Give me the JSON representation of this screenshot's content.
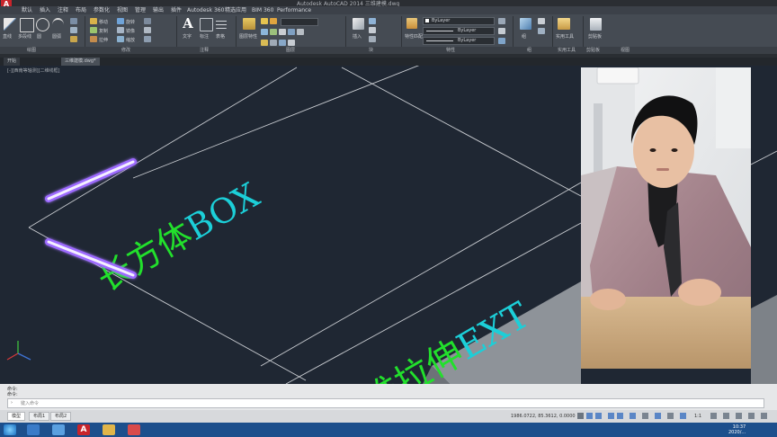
{
  "title": {
    "app_logo": "A",
    "text": "Autodesk AutoCAD 2014  三维建模.dwg"
  },
  "menu": {
    "items": [
      "默认",
      "插入",
      "注释",
      "布局",
      "参数化",
      "视图",
      "管理",
      "输出",
      "插件",
      "Autodesk 360",
      "精选应用",
      "BIM 360",
      "Performance"
    ]
  },
  "ribbon": {
    "properties": {
      "color": "ByLayer",
      "linetype": "ByLayer",
      "lineweight": "ByLayer"
    },
    "buttons": [
      "直线",
      "多段线",
      "圆",
      "圆弧",
      "移动",
      "旋转",
      "复制",
      "镜像",
      "拉伸",
      "缩放",
      "文字",
      "标注",
      "表格",
      "图层特性",
      "插入",
      "特性匹配",
      "组",
      "实用工具",
      "剪贴板"
    ]
  },
  "panels": [
    "绘图",
    "修改",
    "注释",
    "图层",
    "块",
    "特性",
    "组",
    "实用工具",
    "剪贴板",
    "视图"
  ],
  "doc_tabs": [
    "开始",
    "三维建模.dwg*"
  ],
  "viewport_label": "[-][西南等轴测][二维线框]",
  "annotations": {
    "box_cn": "长方体",
    "box_en": "BOX",
    "extrude_cn": "三维拉伸",
    "extrude_en": "EXT"
  },
  "command": {
    "history_1": "命令:",
    "history_2": "命令:",
    "placeholder": "键入命令"
  },
  "layout_tabs": [
    "模型",
    "布局1",
    "布局2"
  ],
  "status": {
    "coords": "1986.0722, 85.3612, 0.0000",
    "scale": "1:1"
  },
  "taskbar": {
    "time": "10:37",
    "date": "2020/..."
  },
  "colors": {
    "text_green": "#22e02c",
    "text_cyan": "#1ccfd8",
    "highlight_purple": "#9d6bff",
    "canvas": "#1f2733"
  }
}
